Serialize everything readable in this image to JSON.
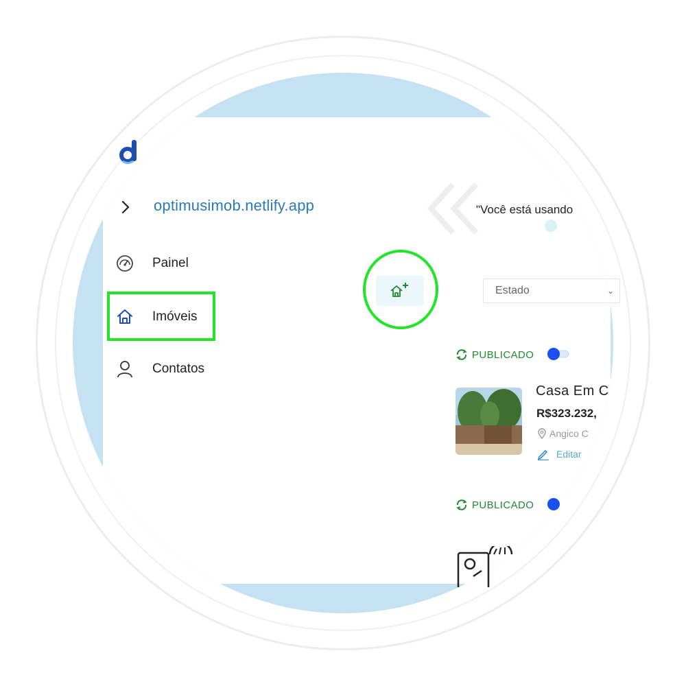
{
  "app": {
    "logo_icon": "d-logo-icon",
    "url": "optimusimob.netlify.app"
  },
  "sidebar": {
    "items": [
      {
        "label": "Painel",
        "icon": "speedometer-icon"
      },
      {
        "label": "Imóveis",
        "icon": "home-icon",
        "active": true
      },
      {
        "label": "Contatos",
        "icon": "user-icon"
      }
    ]
  },
  "toolbar": {
    "add_property_icon": "home-plus-icon"
  },
  "notice": {
    "text": "\"Você está usando"
  },
  "filters": {
    "estado_placeholder": "Estado"
  },
  "listings": [
    {
      "status": "PUBLICADO",
      "published": true,
      "title": "Casa Em C",
      "price": "R$323.232,",
      "location": "Angico C",
      "edit_label": "Editar"
    },
    {
      "status": "PUBLICADO",
      "published": true
    }
  ],
  "colors": {
    "accent": "#2a7ab8",
    "highlight": "#22e52a",
    "status_green": "#1f8a2e",
    "toggle_blue": "#1a4ff0",
    "backdrop_blue": "#c5e2f2"
  }
}
